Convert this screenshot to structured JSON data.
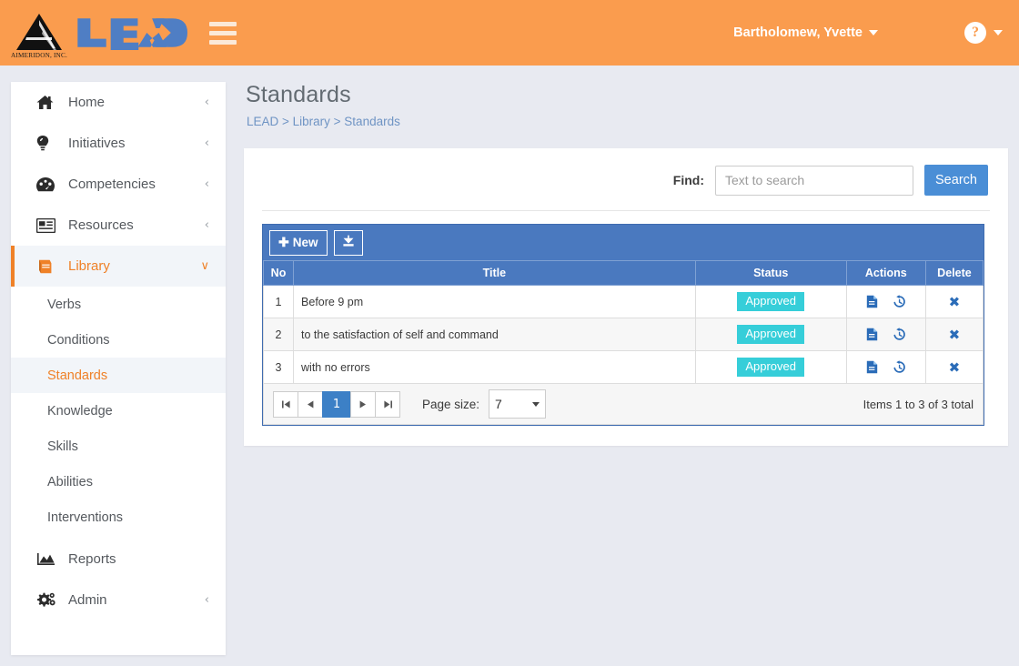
{
  "topbar": {
    "logo_company": "AIMERIDON, INC.",
    "wordmark": "LEAD",
    "menu_icon": "hamburger-icon",
    "user_name": "Bartholomew, Yvette",
    "help_icon": "question-mark-icon"
  },
  "sidebar": {
    "items": [
      {
        "label": "Home",
        "icon": "home-icon",
        "chevron": "‹",
        "active": false
      },
      {
        "label": "Initiatives",
        "icon": "lightbulb-icon",
        "chevron": "‹",
        "active": false
      },
      {
        "label": "Competencies",
        "icon": "dashboard-icon",
        "chevron": "‹",
        "active": false
      },
      {
        "label": "Resources",
        "icon": "newspaper-icon",
        "chevron": "‹",
        "active": false
      },
      {
        "label": "Library",
        "icon": "book-icon",
        "chevron": "∨",
        "active": true
      }
    ],
    "sub_items": [
      {
        "label": "Verbs",
        "active": false
      },
      {
        "label": "Conditions",
        "active": false
      },
      {
        "label": "Standards",
        "active": true
      },
      {
        "label": "Knowledge",
        "active": false
      },
      {
        "label": "Skills",
        "active": false
      },
      {
        "label": "Abilities",
        "active": false
      },
      {
        "label": "Interventions",
        "active": false
      }
    ],
    "bottom_items": [
      {
        "label": "Reports",
        "icon": "chart-icon",
        "chevron": "",
        "active": false
      },
      {
        "label": "Admin",
        "icon": "gears-icon",
        "chevron": "‹",
        "active": false
      }
    ]
  },
  "main": {
    "page_title": "Standards",
    "breadcrumb": "LEAD > Library > Standards"
  },
  "search": {
    "find_label": "Find:",
    "placeholder": "Text to search",
    "value": "",
    "button_label": "Search"
  },
  "grid": {
    "toolbar": {
      "new_label": "New",
      "new_plus": "＋",
      "export_icon": "download-icon"
    },
    "columns": [
      "No",
      "Title",
      "Status",
      "Actions",
      "Delete"
    ],
    "rows": [
      {
        "no": "1",
        "title": "Before 9 pm",
        "status": "Approved"
      },
      {
        "no": "2",
        "title": "to the satisfaction of self and command",
        "status": "Approved"
      },
      {
        "no": "3",
        "title": "with no errors",
        "status": "Approved"
      }
    ],
    "row_actions": {
      "view_icon": "document-icon",
      "history_icon": "history-icon",
      "delete_icon": "x-icon",
      "delete_glyph": "✖"
    },
    "pager": {
      "first": "⏮",
      "prev": "◀",
      "current_page": "1",
      "next": "▶",
      "last": "⏭",
      "page_size_label": "Page size:",
      "page_size_value": "7",
      "items_total": "Items 1 to 3 of 3 total"
    }
  },
  "colors": {
    "brand_orange": "#fa9c4e",
    "accent_blue": "#4a79bf",
    "status_teal": "#36ced9",
    "page_bg": "#e8eaf1"
  }
}
